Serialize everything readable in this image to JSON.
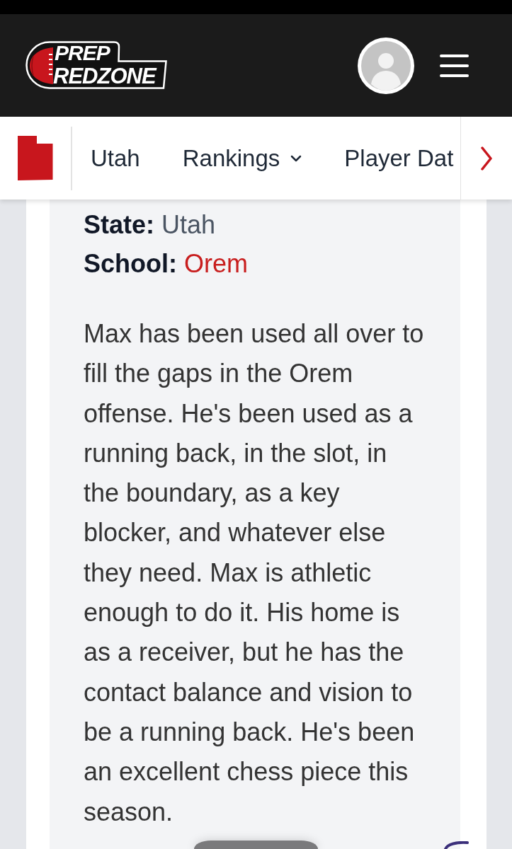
{
  "header": {
    "logo": {
      "line_1": "PREP",
      "line_2": "REDZONE"
    }
  },
  "nav": {
    "items": [
      {
        "label": "Utah",
        "kind": "link"
      },
      {
        "label": "Rankings",
        "kind": "dropdown"
      },
      {
        "label": "Player Dat",
        "kind": "link"
      }
    ]
  },
  "profile": {
    "fields": [
      {
        "label": "State:",
        "value": "Utah",
        "kind": "text"
      },
      {
        "label": "School:",
        "value": "Orem",
        "kind": "link"
      }
    ],
    "bio": "Max has been used all over to fill the gaps in the Orem offense. He's been used as a running back, in the slot, in the boundary, as a key blocker, and whatever else they need. Max is athletic enough to do it. His home is as a receiver, but he has the contact balance and vision to be a running back. He's been an excellent chess piece this season."
  }
}
